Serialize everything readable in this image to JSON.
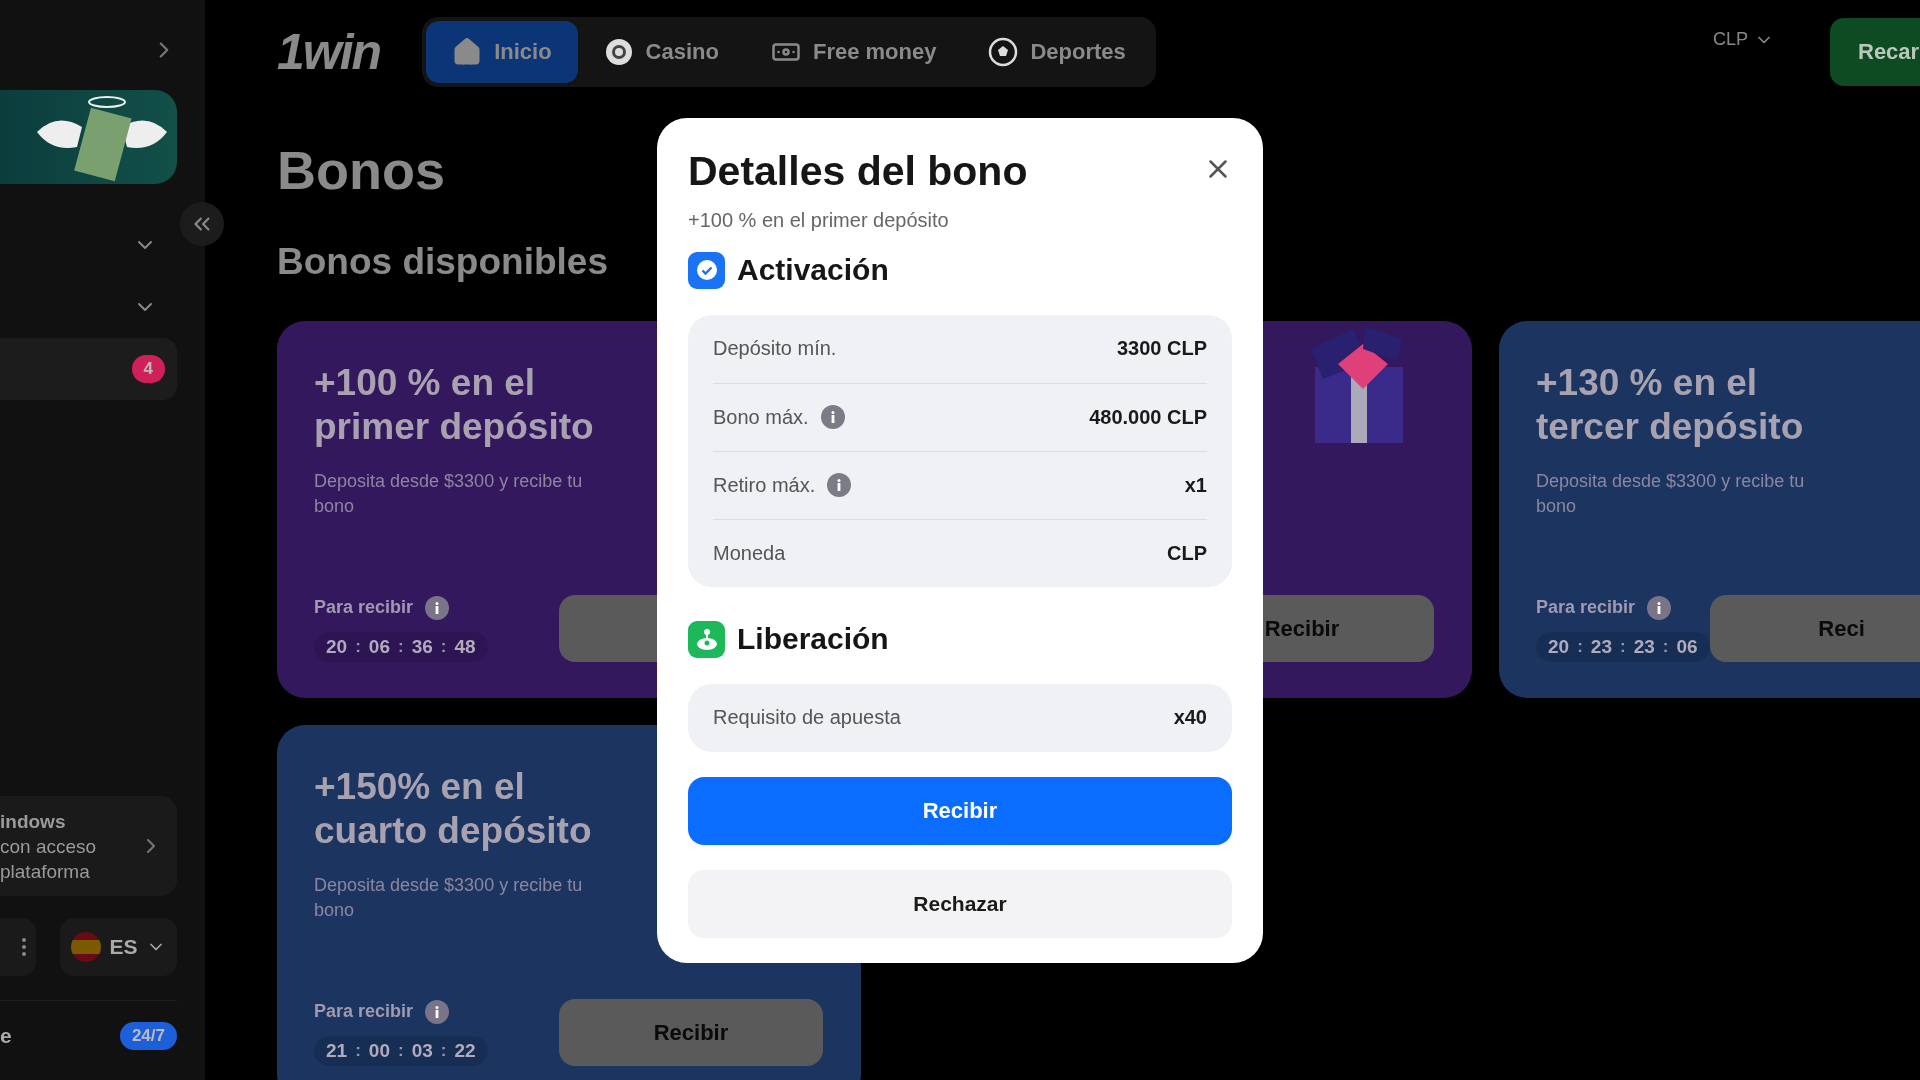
{
  "sidebar": {
    "items": [
      {
        "kind": "dropdown"
      },
      {
        "kind": "dropdown"
      },
      {
        "kind": "badge",
        "badge": "4"
      }
    ],
    "app_card": {
      "lines": [
        "indows",
        "con acceso",
        "plataforma"
      ]
    },
    "language": {
      "code": "ES"
    },
    "support": {
      "label": "e",
      "badge": "24/7"
    }
  },
  "header": {
    "logo": "1win",
    "tabs": [
      {
        "label": "Inicio",
        "selected": true
      },
      {
        "label": "Casino",
        "selected": false
      },
      {
        "label": "Free money",
        "selected": false
      },
      {
        "label": "Deportes",
        "selected": false
      }
    ],
    "currency": "CLP",
    "deposit_button": "Recar"
  },
  "page_title": "Bonos",
  "section_title": "Bonos disponibles",
  "cards": [
    {
      "kind": "offer",
      "color": "#33185e",
      "title_lines": [
        "+100 % en el",
        "primer depósito"
      ],
      "description": "Deposita desde $3300 y recibe tu bono",
      "timer_label": "Para recibir",
      "timer": [
        "20",
        "06",
        "36",
        "48"
      ]
    },
    {
      "kind": "promo_image",
      "color": "#33185e",
      "button": "Recibir"
    },
    {
      "kind": "offer",
      "color": "#1b3560",
      "title_lines": [
        "+130 % en el",
        "tercer depósito"
      ],
      "description": "Deposita desde $3300 y recibe tu bono",
      "timer_label": "Para recibir",
      "timer": [
        "20",
        "23",
        "23",
        "06"
      ],
      "button": "Reci"
    },
    {
      "kind": "offer",
      "color": "#1b3560",
      "title_lines": [
        "+150% en el",
        "cuarto depósito"
      ],
      "description": "Deposita desde $3300 y recibe tu bono",
      "timer_label": "Para recibir",
      "timer": [
        "21",
        "00",
        "03",
        "22"
      ],
      "button": "Recibir"
    }
  ],
  "timer_separator": ":",
  "modal": {
    "title": "Detalles del bono",
    "subtitle": "+100 % en el primer depósito",
    "sections": [
      {
        "kind": "activation",
        "title": "Activación",
        "rows": [
          {
            "label": "Depósito mín.",
            "value": "3300 CLP",
            "info": false
          },
          {
            "label": "Bono máx.",
            "value": "480.000 CLP",
            "info": true
          },
          {
            "label": "Retiro máx.",
            "value": "x1",
            "info": true
          },
          {
            "label": "Moneda",
            "value": "CLP",
            "info": false
          }
        ]
      },
      {
        "kind": "release",
        "title": "Liberación",
        "rows": [
          {
            "label": "Requisito de apuesta",
            "value": "x40",
            "info": false
          }
        ]
      }
    ],
    "primary_button": "Recibir",
    "secondary_button": "Rechazar"
  }
}
